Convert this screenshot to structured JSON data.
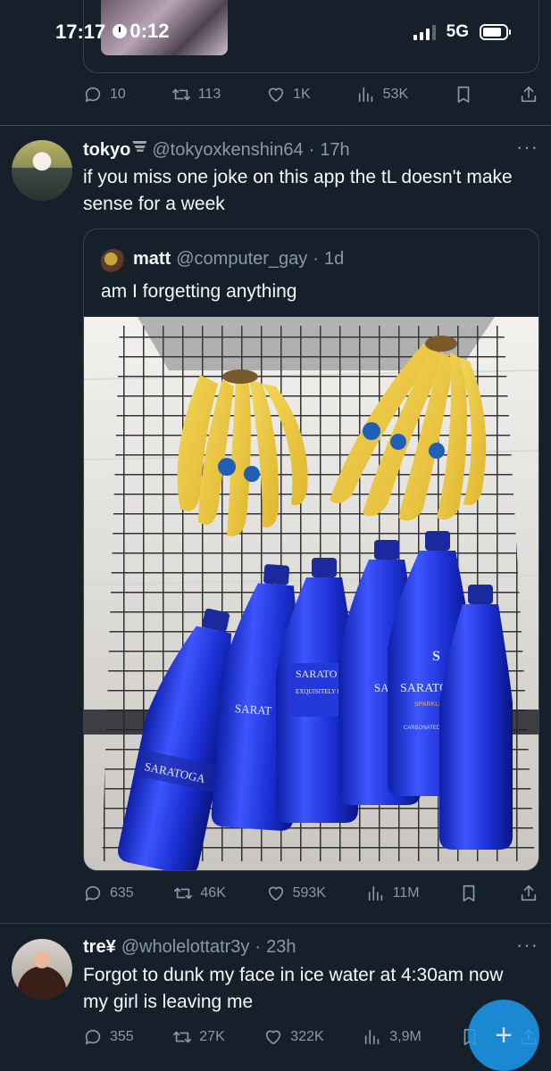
{
  "status_bar": {
    "time": "17:17",
    "timer": "0:12",
    "network": "5G"
  },
  "tweets": [
    {
      "stats": {
        "replies": "10",
        "reposts": "113",
        "likes": "1K",
        "views": "53K"
      }
    },
    {
      "name": "tokyo",
      "handle": "@tokyoxkenshin64",
      "age": "17h",
      "text": "if you miss one joke on this app the tL doesn't make sense for a week",
      "quote": {
        "name": "matt",
        "handle": "@computer_gay",
        "age": "1d",
        "text": "am I forgetting anything",
        "image_labels": [
          "SARATOGA",
          "SARAT",
          "SARATO",
          "EXQUISITELY Effervescent",
          "SA",
          "SARATOGA",
          "SPARKLING",
          "CARBONATED SPRING WATER"
        ]
      },
      "stats": {
        "replies": "635",
        "reposts": "46K",
        "likes": "593K",
        "views": "11M"
      }
    },
    {
      "name": "tre¥",
      "handle": "@wholelottatr3y",
      "age": "23h",
      "text": "Forgot to dunk my face in ice water at 4:30am now my girl is leaving me",
      "stats": {
        "replies": "355",
        "reposts": "27K",
        "likes": "322K",
        "views": "3,9M"
      }
    }
  ],
  "ui": {
    "more": "···",
    "dot": "·",
    "fab": "+"
  },
  "colors": {
    "background": "#15202b",
    "text": "#f7f9f9",
    "muted": "#8b98a5",
    "border": "#38444d",
    "accent": "#1d9bf0"
  }
}
